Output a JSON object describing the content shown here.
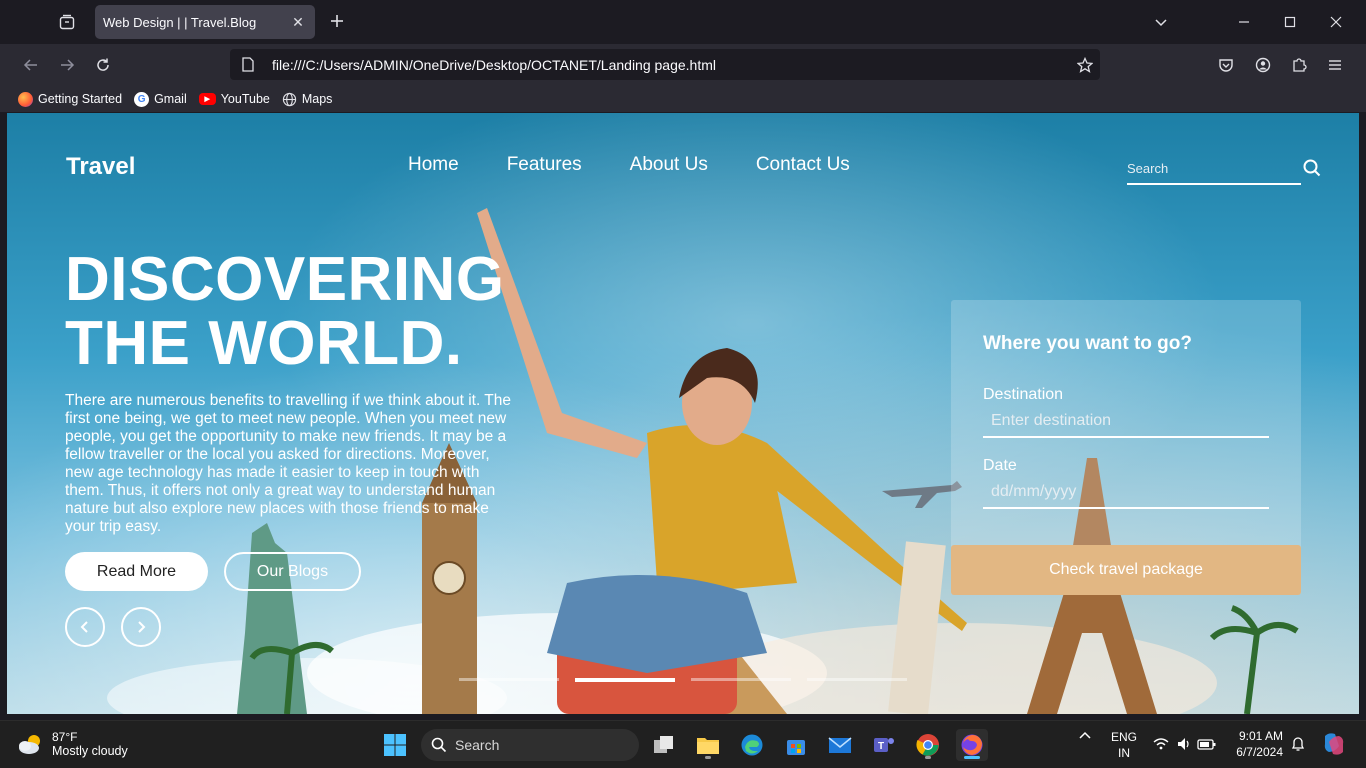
{
  "browser": {
    "tab_title": "Web Design | | Travel.Blog",
    "url": "file:///C:/Users/ADMIN/OneDrive/Desktop/OCTANET/Landing page.html",
    "bookmarks": [
      {
        "label": "Getting Started",
        "icon": "firefox-icon"
      },
      {
        "label": "Gmail",
        "icon": "google-icon"
      },
      {
        "label": "YouTube",
        "icon": "youtube-icon"
      },
      {
        "label": "Maps",
        "icon": "globe-icon"
      }
    ]
  },
  "site": {
    "logo": "Travel",
    "menu": [
      "Home",
      "Features",
      "About Us",
      "Contact Us"
    ],
    "search_placeholder": "Search",
    "hero_title_line1": "DISCOVERING",
    "hero_title_line2": "THE WORLD.",
    "hero_text": "There are numerous benefits to travelling if we think about it. The first one being, we get to meet new people. When you meet new people, you get the opportunity to make new friends. It may be a fellow traveller or the local you asked for directions. Moreover, new age technology has made it easier to keep in touch with them. Thus, it offers not only a great way to understand human nature but also explore new places with those friends to make your trip easy.",
    "read_more": "Read More",
    "our_blogs": "Our Blogs",
    "booking": {
      "title": "Where you want to go?",
      "destination_label": "Destination",
      "destination_placeholder": "Enter destination",
      "date_label": "Date",
      "date_placeholder": "dd/mm/yyyy",
      "submit": "Check travel package"
    },
    "slider": {
      "count": 4,
      "active_index": 1
    }
  },
  "taskbar": {
    "weather_temp": "87°F",
    "weather_cond": "Mostly cloudy",
    "search_label": "Search",
    "lang_line1": "ENG",
    "lang_line2": "IN",
    "time": "9:01 AM",
    "date": "6/7/2024"
  },
  "colors": {
    "accent_button": "#e2b783",
    "browser_bg": "#1c1b22",
    "taskbar_bg": "#202020"
  }
}
